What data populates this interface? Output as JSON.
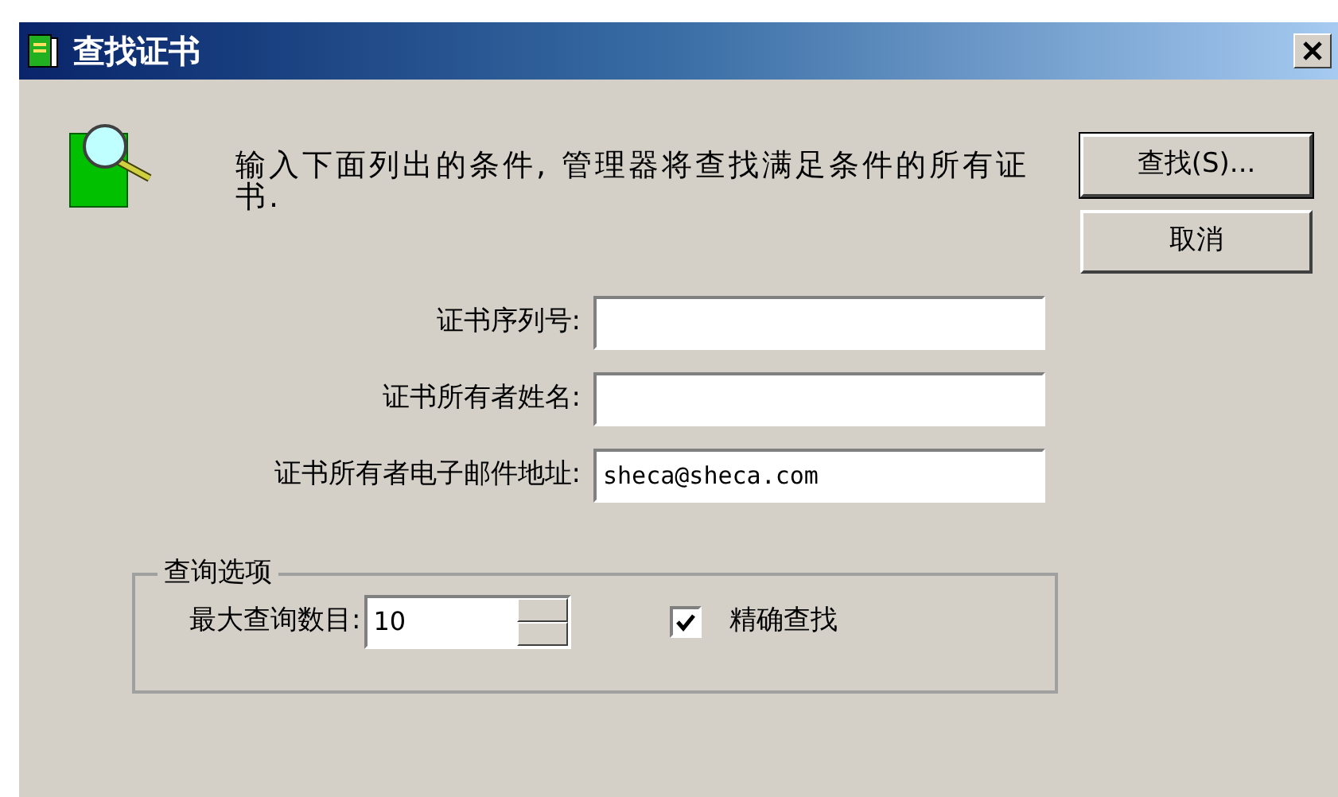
{
  "window": {
    "title": "查找证书"
  },
  "description": "输入下面列出的条件, 管理器将查找满足条件的所有证书.",
  "buttons": [
    {
      "label": "查找(S)...",
      "default": true
    },
    {
      "label": "取消",
      "default": false
    }
  ],
  "fields": [
    {
      "label": "证书序列号:"
    },
    {
      "label": "证书所有者姓名:"
    },
    {
      "label": "证书所有者电子邮件地址:",
      "value": "sheca@sheca.com"
    }
  ],
  "options": {
    "title": "查询选项",
    "max_label": "最大查询数目:",
    "max_value": "10",
    "exact": {
      "label": "精确查找",
      "checked": true
    }
  }
}
